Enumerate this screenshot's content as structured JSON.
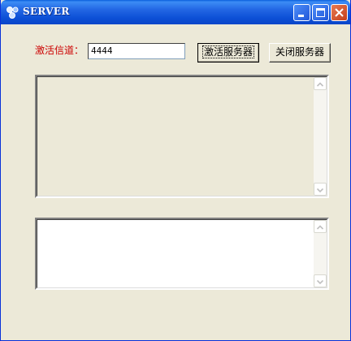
{
  "window": {
    "title": "SERVER",
    "icon": "app-server-icon",
    "controls": [
      "minimize-icon",
      "maximize-icon",
      "close-icon"
    ]
  },
  "form": {
    "channel_label": "激活信道：",
    "channel_value": "4444",
    "activate_button": "激活服务器",
    "close_button": "关闭服务器"
  },
  "colors": {
    "label_color": "#cc0000",
    "window_bg": "#ece9d8",
    "titlebar": "#2266e3"
  }
}
